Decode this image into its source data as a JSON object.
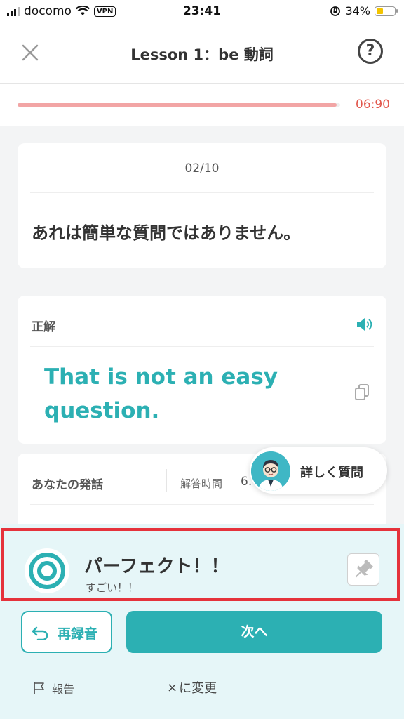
{
  "status_bar": {
    "carrier": "docomo",
    "vpn": "VPN",
    "time": "23:41",
    "battery": "34%",
    "battery_level": 0.34
  },
  "header": {
    "title": "Lesson 1：be 動詞",
    "close_icon": "close-icon",
    "help_icon": "question-mark-icon"
  },
  "timer": {
    "progress": 0.99,
    "value": "06:90",
    "color": "#e2574c"
  },
  "question": {
    "counter": "02/10",
    "text": "あれは簡単な質問ではありません。"
  },
  "answer": {
    "label": "正解",
    "text": "That is not an easy question.",
    "speaker_icon": "speaker-icon",
    "copy_icon": "copy-icon",
    "color": "#2cb0b3"
  },
  "your_speech": {
    "label": "あなたの発話",
    "time_label": "解答時間",
    "time_value": "6.",
    "ask_label": "詳しく質問"
  },
  "result": {
    "title": "パーフェクト！！",
    "subtitle": "すごい！！",
    "icon": "target-icon",
    "pin_icon": "pin-icon"
  },
  "actions": {
    "rerecord": "再録音",
    "next": "次へ",
    "report": "報告",
    "change": "に変更",
    "change_mark": "×"
  },
  "colors": {
    "accent": "#2cb0b3",
    "highlight_border": "#e5323b",
    "panel_bg": "#e6f6f8",
    "progress": "#f2a5a5"
  }
}
